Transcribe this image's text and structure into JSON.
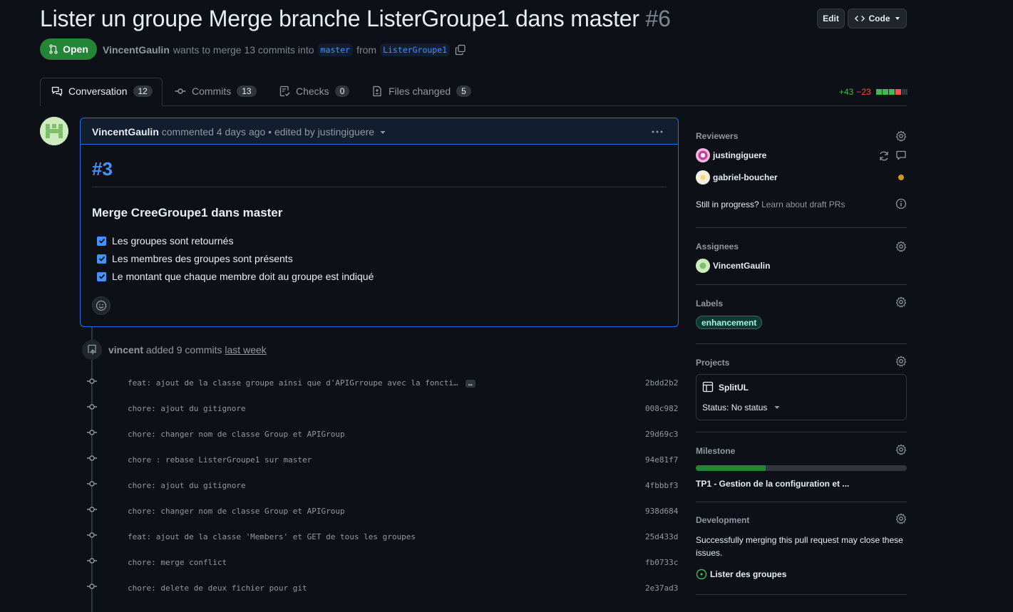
{
  "pr": {
    "title": "Lister un groupe Merge branche ListerGroupe1 dans master",
    "number": "#6",
    "status": "Open",
    "author": "VincentGaulin",
    "merge_text_1": "wants to merge 13 commits into",
    "base_branch": "master",
    "merge_text_2": "from",
    "head_branch": "ListerGroupe1"
  },
  "header_buttons": {
    "edit": "Edit",
    "code": "Code"
  },
  "tabs": [
    {
      "label": "Conversation",
      "count": "12"
    },
    {
      "label": "Commits",
      "count": "13"
    },
    {
      "label": "Checks",
      "count": "0"
    },
    {
      "label": "Files changed",
      "count": "5"
    }
  ],
  "diffstat": {
    "additions": "+43",
    "deletions": "−23"
  },
  "comment": {
    "author": "VincentGaulin",
    "meta": "commented 4 days ago • edited by justingiguere",
    "heading": "#3",
    "subheading": "Merge CreeGroupe1 dans master",
    "tasks": [
      "Les groupes sont retournés",
      "Les membres des groupes sont présents",
      "Le montant que chaque membre doit au groupe est indiqué"
    ]
  },
  "timeline": {
    "actor": "vincent",
    "action": "added 9 commits",
    "when": "last week",
    "commits": [
      {
        "message": "feat: ajout de la classe groupe ainsi que d'APIGrroupe avec la foncti…",
        "sha": "2bdd2b2",
        "ellipsis": "…"
      },
      {
        "message": "chore: ajout du gitignore",
        "sha": "008c982"
      },
      {
        "message": "chore: changer nom de classe Group et APIGroup",
        "sha": "29d69c3"
      },
      {
        "message": "chore : rebase ListerGroupe1 sur master",
        "sha": "94e81f7"
      },
      {
        "message": "chore: ajout du gitignore",
        "sha": "4fbbbf3"
      },
      {
        "message": "chore: changer nom de classe Group et APIGroup",
        "sha": "938d684"
      },
      {
        "message": "feat: ajout de la classe 'Members' et GET de tous les groupes",
        "sha": "25d433d"
      },
      {
        "message": "chore: merge conflict",
        "sha": "fb0733c"
      },
      {
        "message": "chore: delete de deux fichier pour git",
        "sha": "2e37ad3"
      }
    ]
  },
  "sidebar": {
    "reviewers": {
      "label": "Reviewers",
      "users": [
        "justingiguere",
        "gabriel-boucher"
      ],
      "draft_text": "Still in progress?",
      "draft_link": "Learn about draft PRs"
    },
    "assignees": {
      "label": "Assignees",
      "user": "VincentGaulin"
    },
    "labels": {
      "label": "Labels",
      "chip": "enhancement"
    },
    "projects": {
      "label": "Projects",
      "name": "SplitUL",
      "status": "Status: No status"
    },
    "milestone": {
      "label": "Milestone",
      "name": "TP1 - Gestion de la configuration et ...",
      "progress": 0.33
    },
    "development": {
      "label": "Development",
      "text": "Successfully merging this pull request may close these issues.",
      "issue": "Lister des groupes"
    }
  },
  "colors": {
    "accent": "#4493f8",
    "open": "#238636",
    "border": "#30363d",
    "bg": "#0d1117",
    "add": "#3fb950",
    "del": "#f85149",
    "pending": "#d29922"
  }
}
